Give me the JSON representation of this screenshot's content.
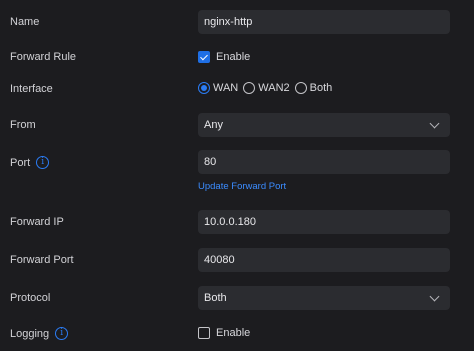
{
  "form": {
    "name": {
      "label": "Name",
      "value": "nginx-http"
    },
    "forward_rule": {
      "label": "Forward Rule",
      "checkbox_label": "Enable",
      "checked": true
    },
    "interface": {
      "label": "Interface",
      "options": [
        "WAN",
        "WAN2",
        "Both"
      ],
      "selected": "WAN"
    },
    "from": {
      "label": "From",
      "value": "Any"
    },
    "port": {
      "label": "Port",
      "value": "80",
      "link": "Update Forward Port"
    },
    "forward_ip": {
      "label": "Forward IP",
      "value": "10.0.0.180"
    },
    "forward_port": {
      "label": "Forward Port",
      "value": "40080"
    },
    "protocol": {
      "label": "Protocol",
      "value": "Both"
    },
    "logging": {
      "label": "Logging",
      "checkbox_label": "Enable",
      "checked": false
    }
  },
  "icons": {
    "info": "info-icon",
    "chevron": "chevron-down-icon",
    "check": "check-icon"
  },
  "colors": {
    "background": "#1c1c1f",
    "field": "#2b2c30",
    "accent": "#2b7cf4",
    "link": "#3b8cff"
  }
}
